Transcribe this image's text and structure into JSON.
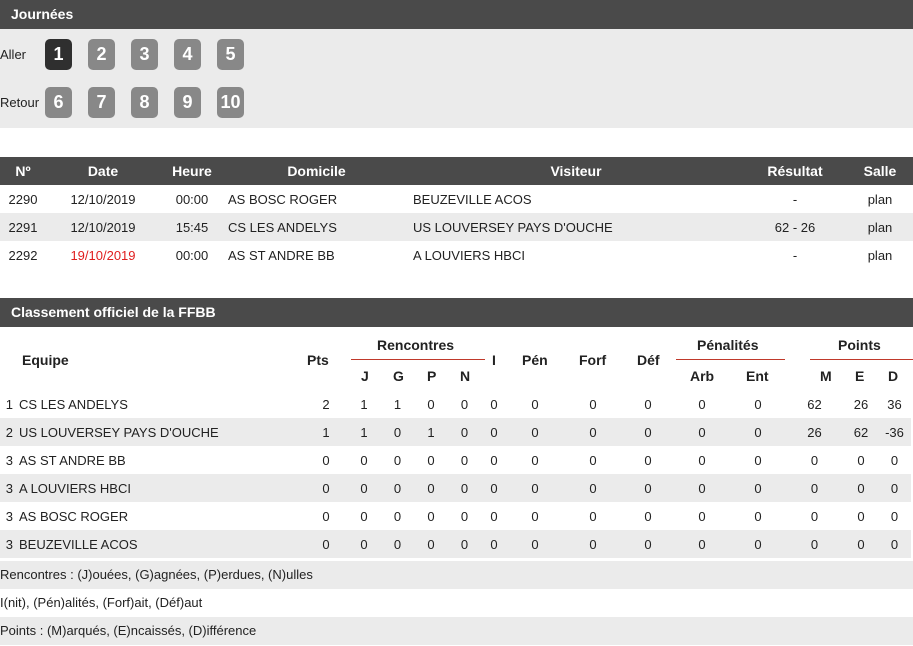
{
  "journees": {
    "title": "Journées",
    "aller_label": "Aller",
    "retour_label": "Retour",
    "aller": [
      "1",
      "2",
      "3",
      "4",
      "5"
    ],
    "retour": [
      "6",
      "7",
      "8",
      "9",
      "10"
    ],
    "active": "1"
  },
  "matches": {
    "headers": [
      "Nº",
      "Date",
      "Heure",
      "Domicile",
      "Visiteur",
      "Résultat",
      "Salle"
    ],
    "rows": [
      {
        "num": "2290",
        "date": "12/10/2019",
        "heure": "00:00",
        "domicile": "AS BOSC ROGER",
        "visiteur": "BEUZEVILLE ACOS",
        "resultat": "-",
        "salle": "plan",
        "date_color": "#222222"
      },
      {
        "num": "2291",
        "date": "12/10/2019",
        "heure": "15:45",
        "domicile": "CS LES ANDELYS",
        "visiteur": "US LOUVERSEY PAYS D'OUCHE",
        "resultat": "62 - 26",
        "salle": "plan",
        "date_color": "#222222"
      },
      {
        "num": "2292",
        "date": "19/10/2019",
        "heure": "00:00",
        "domicile": "AS ST ANDRE BB",
        "visiteur": "A LOUVIERS HBCI",
        "resultat": "-",
        "salle": "plan",
        "date_color": "#e01e1e"
      }
    ]
  },
  "classement": {
    "title": "Classement officiel de la FFBB",
    "headers": {
      "equipe": "Equipe",
      "pts": "Pts",
      "rencontres": "Rencontres",
      "i": "I",
      "pen": "Pén",
      "forf": "Forf",
      "def": "Déf",
      "penalites": "Pénalités",
      "points": "Points",
      "j": "J",
      "g": "G",
      "p": "P",
      "n": "N",
      "arb": "Arb",
      "ent": "Ent",
      "m": "M",
      "e": "E",
      "d": "D"
    },
    "rows": [
      {
        "rank": "1",
        "team": "CS LES ANDELYS",
        "pts": "2",
        "j": "1",
        "g": "1",
        "p": "0",
        "n": "0",
        "i": "0",
        "pen": "0",
        "forf": "0",
        "def": "0",
        "arb": "0",
        "ent": "0",
        "m": "62",
        "e": "26",
        "d": "36"
      },
      {
        "rank": "2",
        "team": "US LOUVERSEY PAYS D'OUCHE",
        "pts": "1",
        "j": "1",
        "g": "0",
        "p": "1",
        "n": "0",
        "i": "0",
        "pen": "0",
        "forf": "0",
        "def": "0",
        "arb": "0",
        "ent": "0",
        "m": "26",
        "e": "62",
        "d": "-36"
      },
      {
        "rank": "3",
        "team": "AS ST ANDRE BB",
        "pts": "0",
        "j": "0",
        "g": "0",
        "p": "0",
        "n": "0",
        "i": "0",
        "pen": "0",
        "forf": "0",
        "def": "0",
        "arb": "0",
        "ent": "0",
        "m": "0",
        "e": "0",
        "d": "0"
      },
      {
        "rank": "3",
        "team": "A LOUVIERS HBCI",
        "pts": "0",
        "j": "0",
        "g": "0",
        "p": "0",
        "n": "0",
        "i": "0",
        "pen": "0",
        "forf": "0",
        "def": "0",
        "arb": "0",
        "ent": "0",
        "m": "0",
        "e": "0",
        "d": "0"
      },
      {
        "rank": "3",
        "team": "AS BOSC ROGER",
        "pts": "0",
        "j": "0",
        "g": "0",
        "p": "0",
        "n": "0",
        "i": "0",
        "pen": "0",
        "forf": "0",
        "def": "0",
        "arb": "0",
        "ent": "0",
        "m": "0",
        "e": "0",
        "d": "0"
      },
      {
        "rank": "3",
        "team": "BEUZEVILLE ACOS",
        "pts": "0",
        "j": "0",
        "g": "0",
        "p": "0",
        "n": "0",
        "i": "0",
        "pen": "0",
        "forf": "0",
        "def": "0",
        "arb": "0",
        "ent": "0",
        "m": "0",
        "e": "0",
        "d": "0"
      }
    ],
    "legend": [
      "Rencontres : (J)ouées, (G)agnées, (P)erdues, (N)ulles",
      "I(nit), (Pén)alités, (Forf)ait, (Déf)aut",
      "Points : (M)arqués, (E)ncaissés, (D)ifférence"
    ]
  },
  "colors": {
    "header_bg": "#4a4a4a",
    "row_alt": "#ebebeb",
    "active_day": "#2f2f2f",
    "day": "#888888",
    "accent_line": "#c0392b"
  }
}
